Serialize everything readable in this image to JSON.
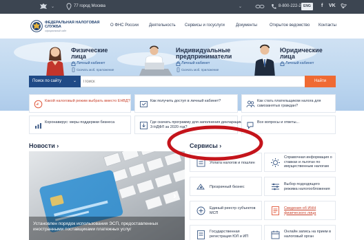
{
  "topbar": {
    "city": "77 город Москва",
    "phone": "8-800-222-2222",
    "lang": "ENG",
    "social": [
      "f",
      "VK",
      "tw"
    ]
  },
  "header": {
    "logo_title": "ФЕДЕРАЛЬНАЯ НАЛОГОВАЯ СЛУЖБА",
    "logo_sub": "официальный сайт",
    "nav": [
      "О ФНС России",
      "Деятельность",
      "Сервисы и госуслуги",
      "Документы",
      "Открытое ведомство",
      "Контакты"
    ]
  },
  "hero": {
    "segments": [
      {
        "title1": "Физические",
        "title2": "лица",
        "link": "Личный кабинет",
        "app": "Скачать моб. приложение"
      },
      {
        "title1": "Индивидуальные",
        "title2": "предприниматели",
        "link": "Личный кабинет",
        "app": "Скачать моб. приложение"
      },
      {
        "title1": "Юридические",
        "title2": "лица",
        "link": "Личный кабинет"
      }
    ]
  },
  "search": {
    "scope": "Поиск по сайту",
    "placeholder": "Поиск",
    "button": "Найти"
  },
  "quick": [
    {
      "text": "Какой налоговый режим выбрать вместо ЕНВД?",
      "red": true
    },
    {
      "text": "Как получить доступ в личный кабинет?",
      "red": false
    },
    {
      "text": "Как стать плательщиком налога для самозанятых граждан?",
      "red": false
    },
    {
      "text": "Коронавирус: меры поддержки бизнеса",
      "red": false
    },
    {
      "text": "Где скачать программу для заполнения декларации 3-НДФЛ за 2020 год?",
      "red": false
    },
    {
      "text": "Все вопросы и ответы...",
      "red": false
    }
  ],
  "sections": {
    "news": "Новости",
    "services": "Сервисы",
    "arrow": "›"
  },
  "news": {
    "caption": "Установлен порядок использования ЭСП, предоставленных иностранными поставщиками платежных услуг"
  },
  "services": [
    {
      "text": "Уплата налогов и пошлин"
    },
    {
      "text": "Справочная информация о ставках и льготах по имущественным налогам"
    },
    {
      "text": "Прозрачный бизнес"
    },
    {
      "text": "Выбор подходящего режима налогообложения"
    },
    {
      "text": "Единый реестр субъектов МСП"
    },
    {
      "text": "Сведения об ИНН физического лица",
      "highlight": true
    },
    {
      "text": "Государственная регистрация ЮЛ и ИП"
    },
    {
      "text": "Онлайн запись на прием в налоговый орган"
    }
  ],
  "colors": {
    "accent": "#ef6a33",
    "brand": "#1f4a86",
    "annotation": "#c4141b"
  }
}
